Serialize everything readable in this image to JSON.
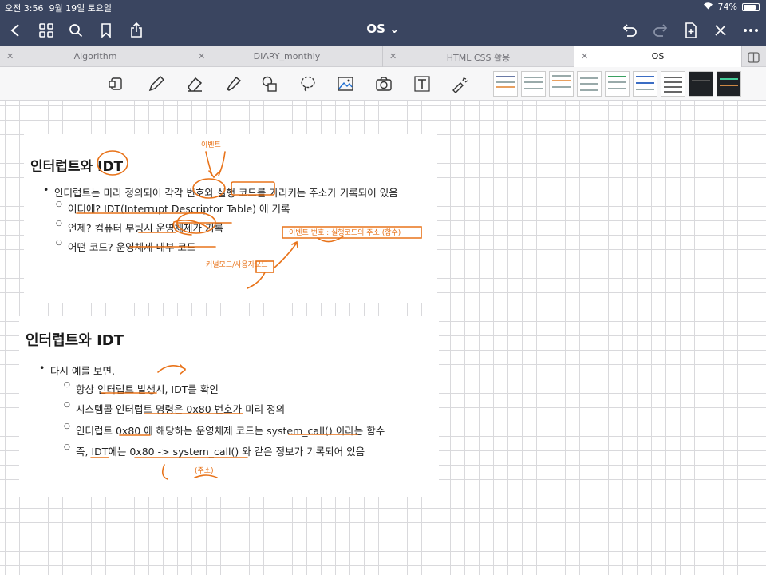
{
  "status_bar": {
    "time": "오전 3:56",
    "date": "9월 19일 토요일",
    "battery": "74%",
    "battery_level": 0.74
  },
  "nav": {
    "title": "OS ⌄"
  },
  "tabs": [
    {
      "label": "Algorithm"
    },
    {
      "label": "DIARY_monthly"
    },
    {
      "label": "HTML CSS 활용"
    },
    {
      "label": "OS"
    }
  ],
  "tools": [
    "lasso-image-tool",
    "pen-tool",
    "eraser-tool",
    "highlighter-tool",
    "shapes-tool",
    "lasso-tool",
    "image-tool",
    "camera-tool",
    "text-tool",
    "laser-pointer-tool"
  ],
  "colors": {
    "accent": "#3a4560",
    "ink": "#e8731a"
  },
  "slide1": {
    "title": "인터럽트와 IDT",
    "bullets": [
      {
        "level": "main",
        "text": "인터럽트는 미리 정의되어 각각 번호와 실행 코드를 가리키는 주소가 기록되어 있음"
      },
      {
        "level": "sub",
        "text": "어디에? IDT(Interrupt Descriptor Table) 에 기록"
      },
      {
        "level": "sub",
        "text": "언제? 컴퓨터 부팅시 운영체제가 기록"
      },
      {
        "level": "sub",
        "text": "어떤 코드? 운영체제 내부 코드"
      }
    ]
  },
  "slide2": {
    "title": "인터럽트와 IDT",
    "bullets": [
      {
        "level": "main",
        "text": "다시 예를 보면,"
      },
      {
        "level": "sub",
        "text": "항상 인터럽트 발생시, IDT를 확인"
      },
      {
        "level": "sub",
        "text": "시스템콜 인터럽트 명령은 0x80 번호가 미리 정의"
      },
      {
        "level": "sub",
        "text": "인터럽트 0x80 에 해당하는 운영체제 코드는 system_call() 이라는 함수"
      },
      {
        "level": "sub",
        "text": "즉, IDT에는 0x80 -> system_call() 와 같은 정보가 기록되어 있음"
      }
    ]
  },
  "handwriting": {
    "n1": "이벤트",
    "n2": "이벤트 번호 : 실행코드의 주소 (함수)",
    "n3": "커널모드/사용자모드",
    "n4": "(주소)"
  }
}
